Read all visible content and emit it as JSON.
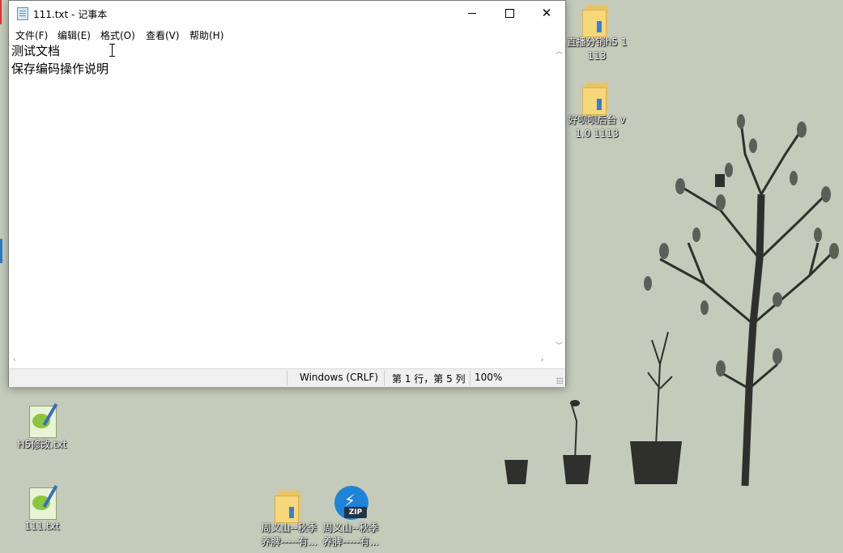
{
  "window": {
    "title": "111.txt - 记事本",
    "menu": [
      "文件(F)",
      "编辑(E)",
      "格式(O)",
      "查看(V)",
      "帮助(H)"
    ],
    "content_lines": [
      "测试文档",
      "保存编码操作说明"
    ],
    "status": {
      "encoding": "Windows (CRLF)",
      "position": "第 1 行，第 5 列",
      "zoom": "100%"
    }
  },
  "desktop": {
    "icons": {
      "folder_live": "直播分销h5 1113",
      "folder_backend": "好呗呗后台 v1.0 1113",
      "file_h5": "H5修改.txt",
      "file_111": "111.txt",
      "folder_zhou": "周义山--秋季养脾-----有...",
      "zip_zhou": "周义山--秋季养脾-----有..."
    }
  },
  "colors": {
    "desktop_bg": "#c5cbbb",
    "tree": "#2f302d"
  }
}
